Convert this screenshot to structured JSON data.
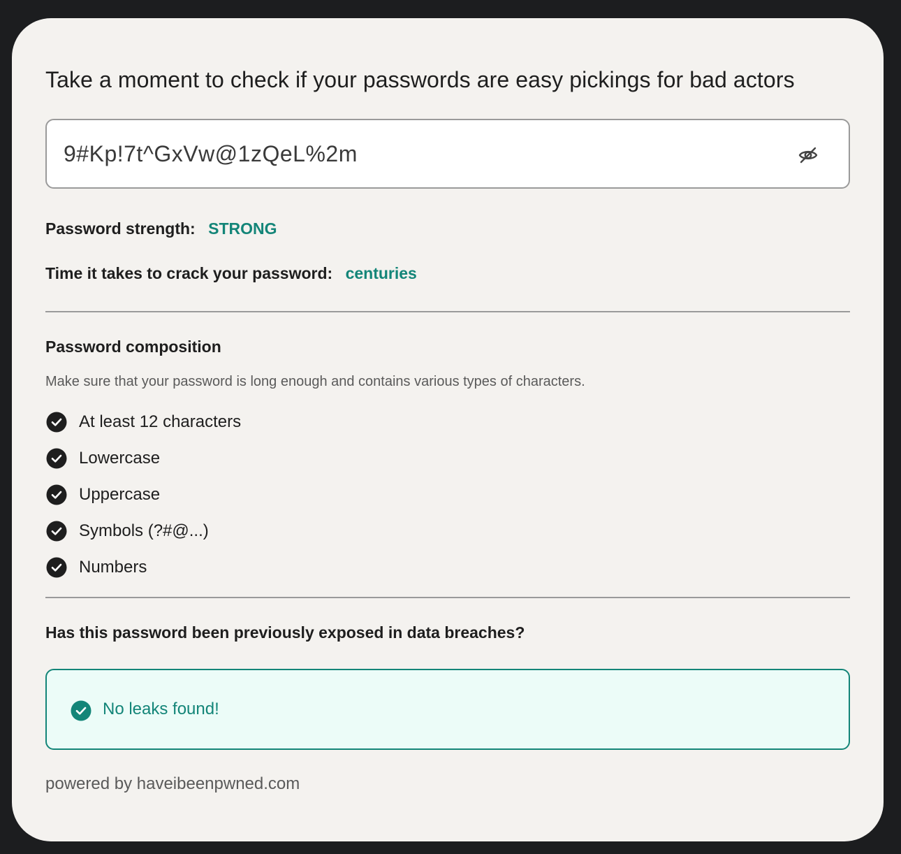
{
  "title": "Take a moment to check if your passwords are easy pickings for bad actors",
  "password_field": {
    "value": "9#Kp!7t^GxVw@1zQeL%2m",
    "toggle_icon": "eye-slash-icon"
  },
  "strength": {
    "label": "Password strength:",
    "value": "STRONG"
  },
  "crack_time": {
    "label": "Time it takes to crack your password:",
    "value": "centuries"
  },
  "composition": {
    "title": "Password composition",
    "hint": "Make sure that your password is long enough and contains various types of characters.",
    "items": [
      {
        "label": "At least 12 characters",
        "checked": true
      },
      {
        "label": "Lowercase",
        "checked": true
      },
      {
        "label": "Uppercase",
        "checked": true
      },
      {
        "label": "Symbols (?#@...)",
        "checked": true
      },
      {
        "label": "Numbers",
        "checked": true
      }
    ]
  },
  "breach": {
    "question": "Has this password been previously exposed in data breaches?",
    "result": "No leaks found!"
  },
  "footer": {
    "powered_by": "powered by haveibeenpwned.com"
  },
  "colors": {
    "accent": "#138578",
    "background": "#1c1d1f",
    "card": "#f4f2ef",
    "success_bg": "#ecfcf8",
    "text": "#1e1e1e"
  }
}
